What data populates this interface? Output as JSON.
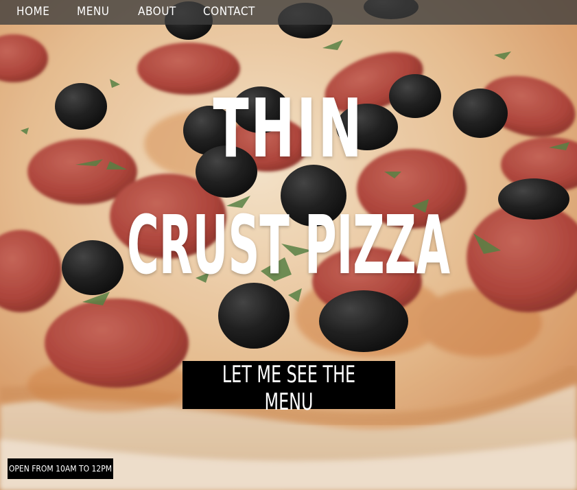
{
  "nav": {
    "items": [
      {
        "label": "HOME"
      },
      {
        "label": "MENU"
      },
      {
        "label": "ABOUT"
      },
      {
        "label": "CONTACT"
      }
    ]
  },
  "hero": {
    "title_line_1": "THIN",
    "title_line_2": "CRUST PIZZA",
    "cta_label": "Let me see the menu",
    "hours": "Open from 10am to 12pm"
  },
  "colors": {
    "navbar": "#3c3c3c",
    "cta_bg": "#000000",
    "text": "#ffffff"
  }
}
